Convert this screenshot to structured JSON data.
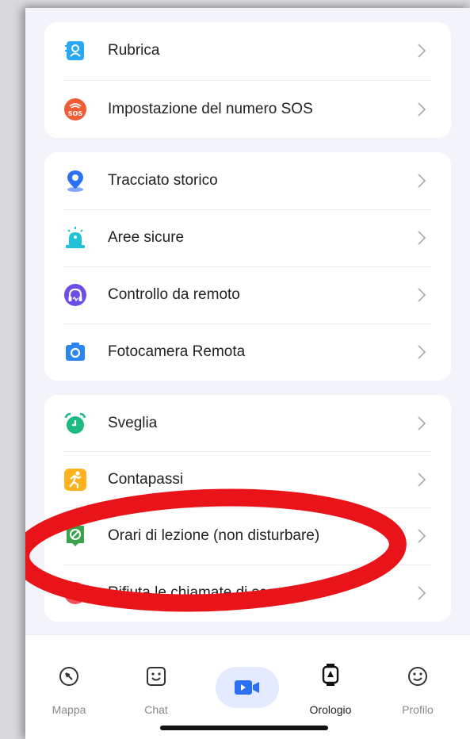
{
  "groups": [
    {
      "items": [
        {
          "label": "Rubrica",
          "icon": "contacts-icon"
        },
        {
          "label": "Impostazione del numero SOS",
          "icon": "sos-icon"
        }
      ]
    },
    {
      "items": [
        {
          "label": "Tracciato storico",
          "icon": "location-pin-icon"
        },
        {
          "label": "Aree sicure",
          "icon": "safe-zone-icon"
        },
        {
          "label": "Controllo da remoto",
          "icon": "remote-control-icon"
        },
        {
          "label": "Fotocamera Remota",
          "icon": "camera-icon"
        }
      ]
    },
    {
      "items": [
        {
          "label": "Sveglia",
          "icon": "alarm-clock-icon"
        },
        {
          "label": "Contapassi",
          "icon": "pedometer-icon"
        },
        {
          "label": "Orari di lezione (non disturbare)",
          "icon": "do-not-disturb-icon"
        },
        {
          "label": "Rifiuta le chiamate di sconosciuti",
          "icon": "block-calls-icon"
        }
      ]
    }
  ],
  "tabbar": {
    "tabs": [
      {
        "label": "Mappa",
        "icon": "compass-icon"
      },
      {
        "label": "Chat",
        "icon": "chat-face-icon"
      },
      {
        "label": "",
        "icon": "video-call-icon"
      },
      {
        "label": "Orologio",
        "icon": "watch-icon",
        "active": true
      },
      {
        "label": "Profilo",
        "icon": "smiley-icon"
      }
    ]
  },
  "colors": {
    "background": "#f2f4f9",
    "accent": "#2d6ff5",
    "annotation": "#e8141a"
  }
}
